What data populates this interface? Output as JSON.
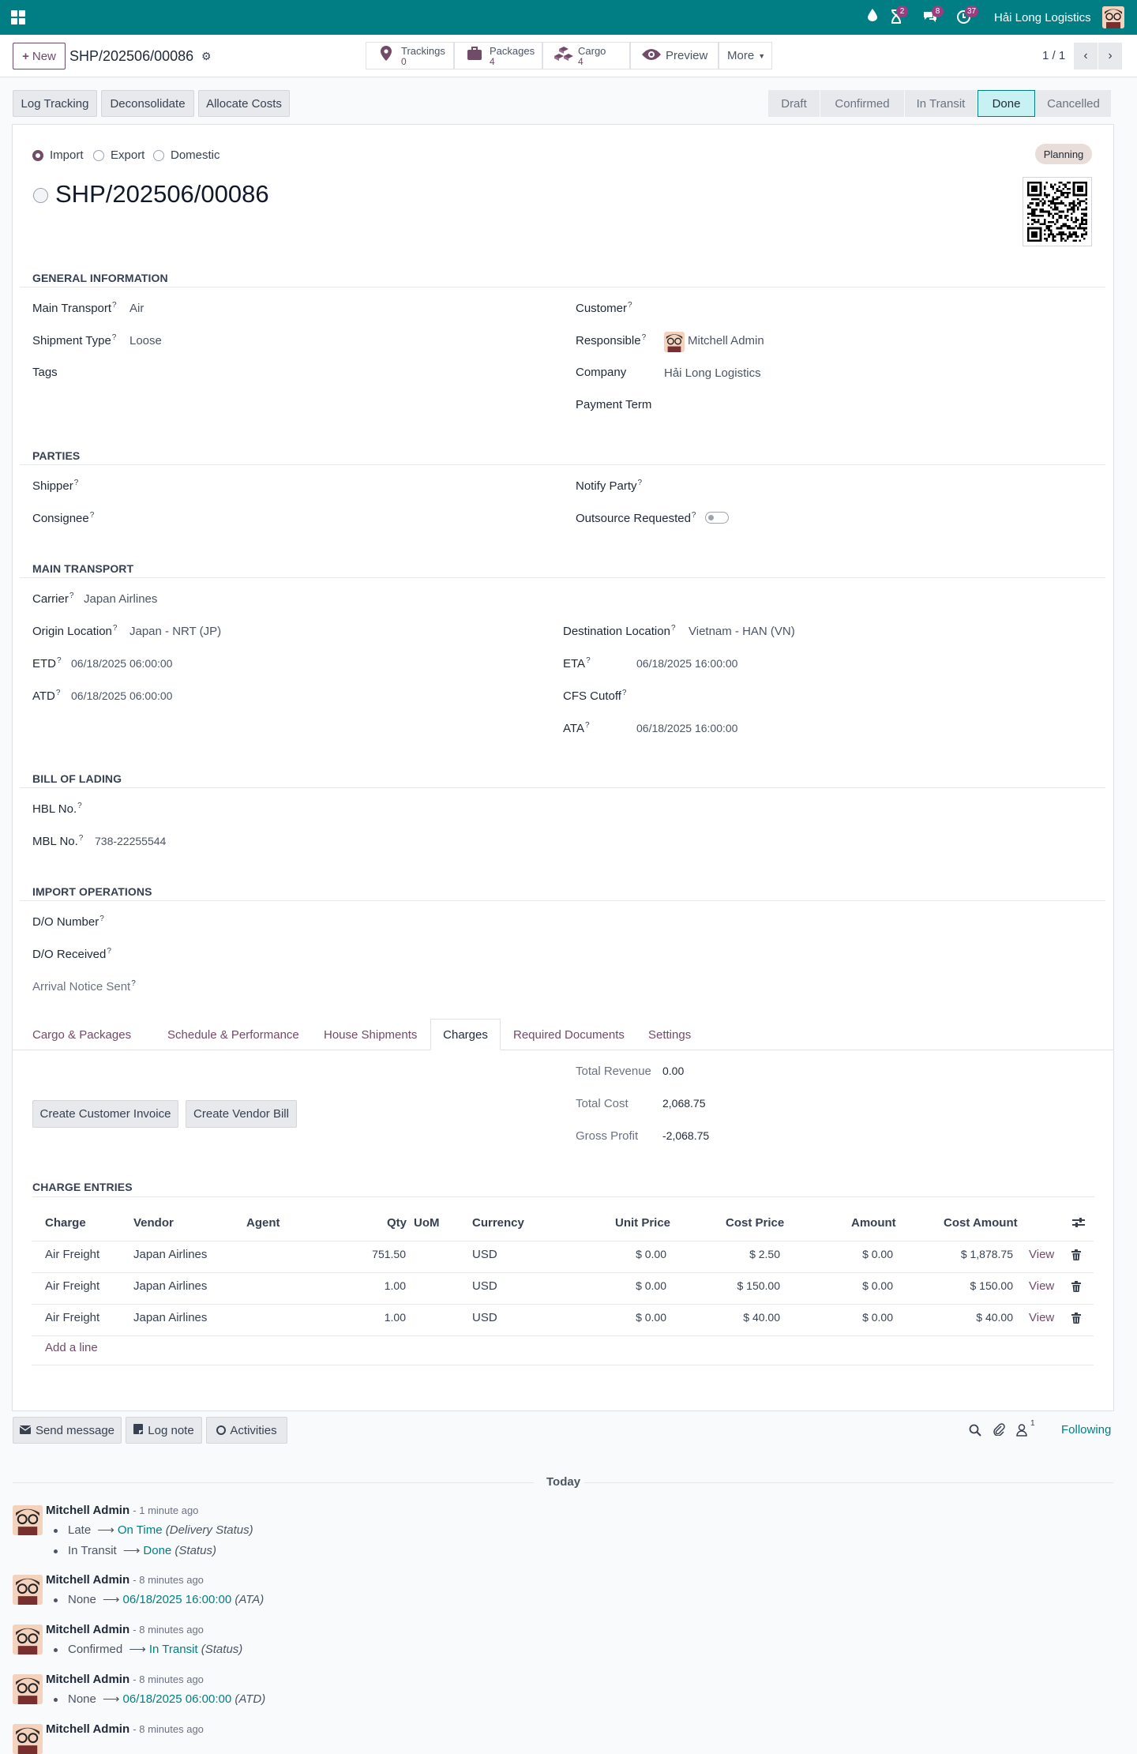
{
  "navbar": {
    "company": "Hải Long Logistics",
    "activity_count": "2",
    "messages_count": "8",
    "activities_count": "37"
  },
  "control": {
    "new_label": "New",
    "record_name": "SHP/202506/00086",
    "trackings_label": "Trackings",
    "trackings_count": "0",
    "packages_label": "Packages",
    "packages_count": "4",
    "cargo_label": "Cargo",
    "cargo_count": "4",
    "preview_label": "Preview",
    "more_label": "More",
    "pager": "1 / 1"
  },
  "actions": {
    "log_tracking": "Log Tracking",
    "deconsolidate": "Deconsolidate",
    "allocate_costs": "Allocate Costs"
  },
  "stages": [
    {
      "label": "Draft",
      "active": false
    },
    {
      "label": "Confirmed",
      "active": false
    },
    {
      "label": "In Transit",
      "active": false
    },
    {
      "label": "Done",
      "active": true
    },
    {
      "label": "Cancelled",
      "active": false
    }
  ],
  "form": {
    "direction_options": [
      "Import",
      "Export",
      "Domestic"
    ],
    "direction_selected": "Import",
    "planning_badge": "Planning",
    "title": "SHP/202506/00086",
    "general_header": "General Information",
    "main_transport_label": "Main Transport",
    "main_transport": "Air",
    "shipment_type_label": "Shipment Type",
    "shipment_type": "Loose",
    "tags_label": "Tags",
    "customer_label": "Customer",
    "responsible_label": "Responsible",
    "responsible": "Mitchell Admin",
    "company_label": "Company",
    "company": "Hải Long Logistics",
    "payment_term_label": "Payment Term",
    "parties_header": "Parties",
    "shipper_label": "Shipper",
    "consignee_label": "Consignee",
    "notify_party_label": "Notify Party",
    "outsource_label": "Outsource Requested",
    "transport_header": "Main Transport",
    "carrier_label": "Carrier",
    "carrier": "Japan Airlines",
    "origin_label": "Origin Location",
    "origin": "Japan - NRT (JP)",
    "destination_label": "Destination Location",
    "destination": "Vietnam - HAN (VN)",
    "etd_label": "ETD",
    "etd": "06/18/2025 06:00:00",
    "atd_label": "ATD",
    "atd": "06/18/2025 06:00:00",
    "eta_label": "ETA",
    "eta": "06/18/2025 16:00:00",
    "cfs_label": "CFS Cutoff",
    "ata_label": "ATA",
    "ata": "06/18/2025 16:00:00",
    "bol_header": "Bill of Lading",
    "hbl_label": "HBL No.",
    "mbl_label": "MBL No.",
    "mbl": "738-22255544",
    "import_header": "Import Operations",
    "do_number_label": "D/O Number",
    "do_received_label": "D/O Received",
    "arrival_notice_label": "Arrival Notice Sent"
  },
  "tabs": [
    "Cargo & Packages",
    "Schedule & Performance",
    "House Shipments",
    "Charges",
    "Required Documents",
    "Settings"
  ],
  "active_tab": "Charges",
  "charges": {
    "create_invoice": "Create Customer Invoice",
    "create_bill": "Create Vendor Bill",
    "total_revenue_label": "Total Revenue",
    "total_revenue": "0.00",
    "total_cost_label": "Total Cost",
    "total_cost": "2,068.75",
    "gross_profit_label": "Gross Profit",
    "gross_profit": "-2,068.75",
    "entries_header": "Charge Entries",
    "columns": [
      "Charge",
      "Vendor",
      "Agent",
      "Qty",
      "UoM",
      "Currency",
      "Unit Price",
      "Cost Price",
      "Amount",
      "Cost Amount"
    ],
    "rows": [
      {
        "charge": "Air Freight",
        "vendor": "Japan Airlines",
        "agent": "",
        "qty": "751.50",
        "uom": "",
        "currency": "USD",
        "unit_price": "$ 0.00",
        "cost_price": "$ 2.50",
        "amount": "$ 0.00",
        "cost_amount": "$ 1,878.75",
        "view": "View"
      },
      {
        "charge": "Air Freight",
        "vendor": "Japan Airlines",
        "agent": "",
        "qty": "1.00",
        "uom": "",
        "currency": "USD",
        "unit_price": "$ 0.00",
        "cost_price": "$ 150.00",
        "amount": "$ 0.00",
        "cost_amount": "$ 150.00",
        "view": "View"
      },
      {
        "charge": "Air Freight",
        "vendor": "Japan Airlines",
        "agent": "",
        "qty": "1.00",
        "uom": "",
        "currency": "USD",
        "unit_price": "$ 0.00",
        "cost_price": "$ 40.00",
        "amount": "$ 0.00",
        "cost_amount": "$ 40.00",
        "view": "View"
      }
    ],
    "add_line": "Add a line"
  },
  "chatter": {
    "send_message": "Send message",
    "log_note": "Log note",
    "activities": "Activities",
    "followers_count": "1",
    "following": "Following",
    "date_separator": "Today",
    "messages": [
      {
        "author": "Mitchell Admin",
        "ago": "- 1 minute ago",
        "changes": [
          {
            "old": "Late",
            "new": "On Time",
            "field": "(Delivery Status)"
          },
          {
            "old": "In Transit",
            "new": "Done",
            "field": "(Status)"
          }
        ]
      },
      {
        "author": "Mitchell Admin",
        "ago": "- 8 minutes ago",
        "changes": [
          {
            "old": "None",
            "new": "06/18/2025 16:00:00",
            "field": "(ATA)"
          }
        ]
      },
      {
        "author": "Mitchell Admin",
        "ago": "- 8 minutes ago",
        "changes": [
          {
            "old": "Confirmed",
            "new": "In Transit",
            "field": "(Status)"
          }
        ]
      },
      {
        "author": "Mitchell Admin",
        "ago": "- 8 minutes ago",
        "changes": [
          {
            "old": "None",
            "new": "06/18/2025 06:00:00",
            "field": "(ATD)"
          }
        ]
      },
      {
        "author": "Mitchell Admin",
        "ago": "- 8 minutes ago",
        "changes": []
      }
    ]
  }
}
